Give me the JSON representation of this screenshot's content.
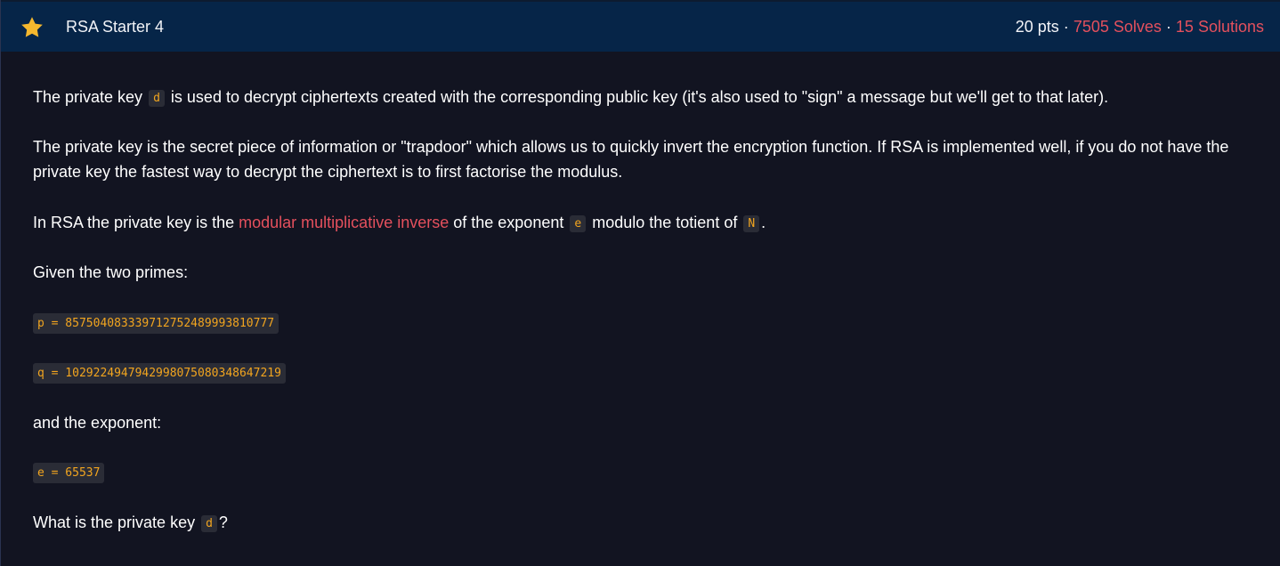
{
  "header": {
    "title": "RSA Starter 4",
    "points": "20 pts",
    "separator": "·",
    "solves": "7505 Solves",
    "solutions": "15 Solutions",
    "icon": "star-icon",
    "accent": "#e4505d",
    "star_color": "#f5b82e"
  },
  "content": {
    "p1_a": "The private key",
    "p1_code": "d",
    "p1_b": "is used to decrypt ciphertexts created with the corresponding public key (it's also used to \"sign\" a message but we'll get to that later).",
    "p2": "The private key is the secret piece of information or \"trapdoor\" which allows us to quickly invert the encryption function. If RSA is implemented well, if you do not have the private key the fastest way to decrypt the ciphertext is to first factorise the modulus.",
    "p3_a": "In RSA the private key is the",
    "p3_link": "modular multiplicative inverse",
    "p3_b": "of the exponent",
    "p3_code_e": "e",
    "p3_c": "modulo the totient of",
    "p3_code_n": "N",
    "p3_d": ".",
    "p4": "Given the two primes:",
    "p_value": "p = 857504083339712752489993810777",
    "q_value": "q = 1029224947942998075080348647219",
    "p5": "and the exponent:",
    "e_value": "e = 65537",
    "p6_a": "What is the private key",
    "p6_code": "d",
    "p6_b": "?"
  }
}
